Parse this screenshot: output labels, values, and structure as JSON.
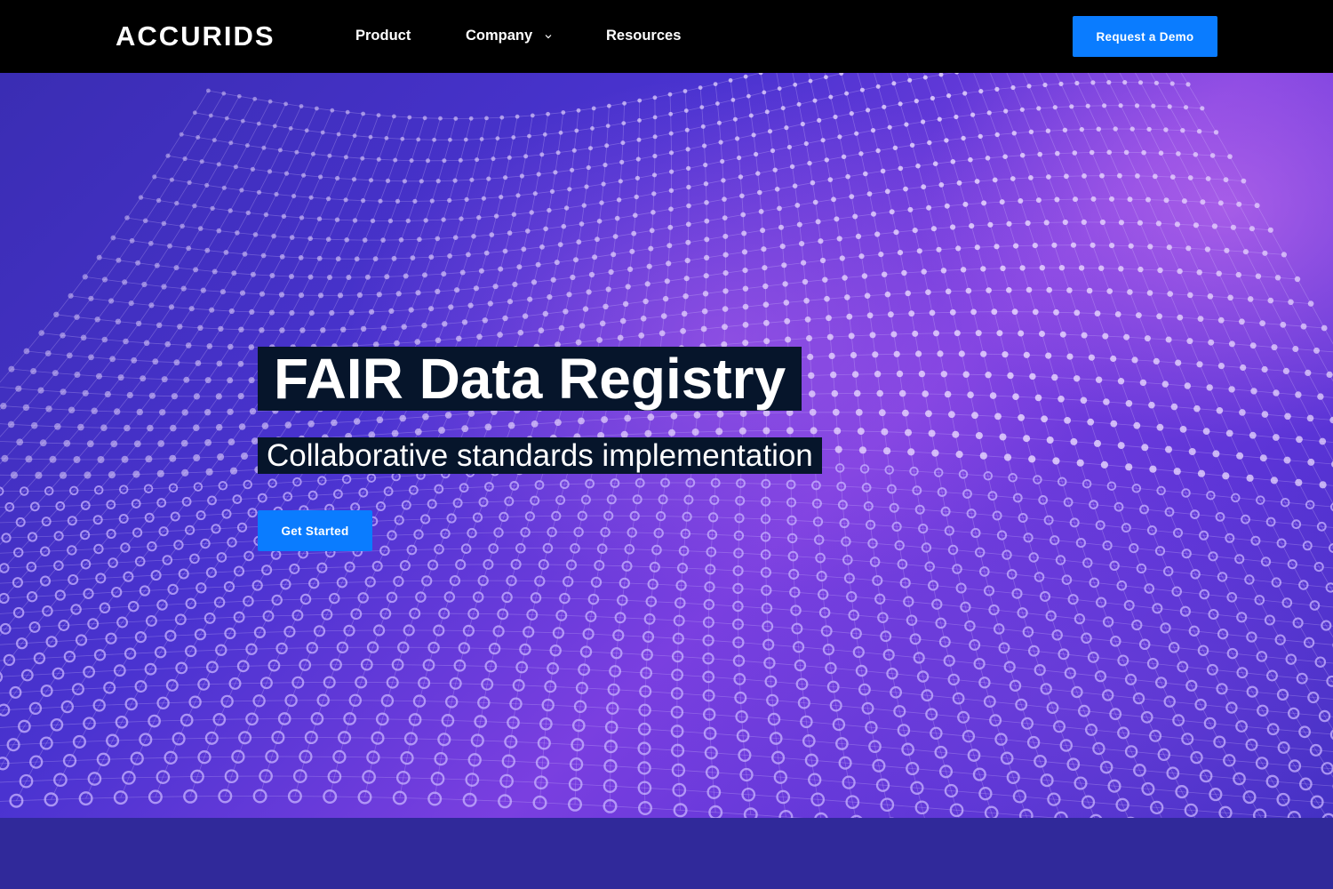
{
  "brand": {
    "logo_text": "ACCURIDS"
  },
  "nav": {
    "items": [
      {
        "label": "Product"
      },
      {
        "label": "Company",
        "has_dropdown": true
      },
      {
        "label": "Resources"
      }
    ],
    "demo_label": "Request a Demo"
  },
  "hero": {
    "title": "FAIR Data Registry",
    "subtitle": "Collaborative standards implementation",
    "cta_label": "Get Started",
    "background": "purple-dotted-mesh-wave"
  },
  "colors": {
    "nav_bg": "#000000",
    "accent": "#0a7cff",
    "label_bg": "#06152b",
    "hero_purple": "#5b34d6",
    "band": "#30299a"
  },
  "icons": {
    "dropdown": "chevron-down-icon"
  }
}
